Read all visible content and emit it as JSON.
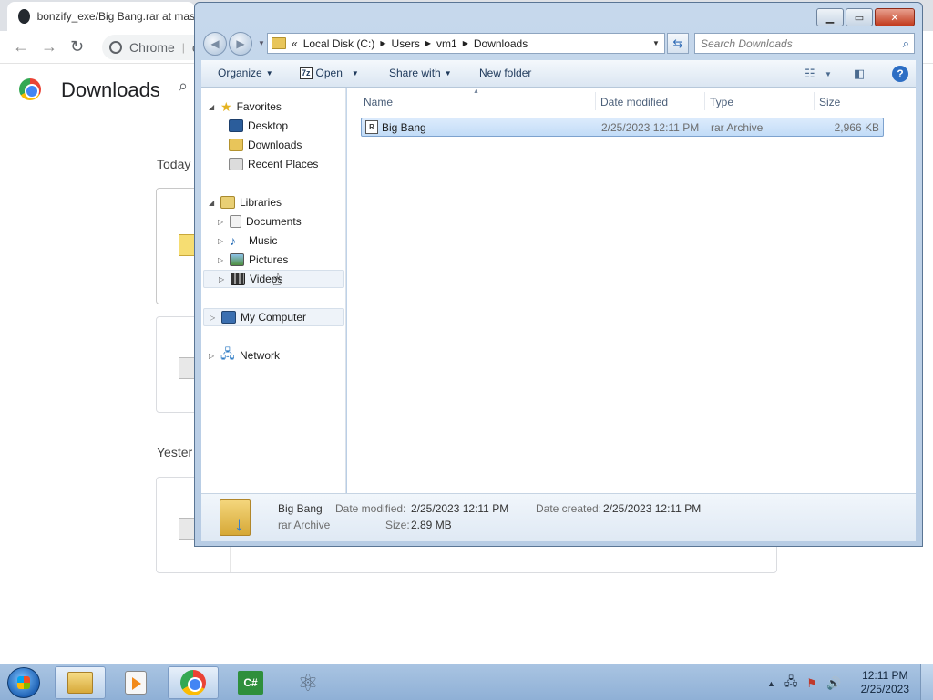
{
  "chrome": {
    "tab_title": "bonzify_exe/Big Bang.rar at mas",
    "omnibox_label": "Chrome",
    "omnibox_sep": "|",
    "omnibox_cut": "c",
    "page_title": "Downloads",
    "section_today": "Today",
    "section_yesterday": "Yester"
  },
  "explorer": {
    "address": [
      "Local Disk (C:)",
      "Users",
      "vm1",
      "Downloads"
    ],
    "address_prefix": "«",
    "search_placeholder": "Search Downloads",
    "commands": {
      "organize": "Organize",
      "open": "Open",
      "share_with": "Share with",
      "new_folder": "New folder"
    },
    "nav": {
      "favorites": "Favorites",
      "desktop": "Desktop",
      "downloads": "Downloads",
      "recent_places": "Recent Places",
      "libraries": "Libraries",
      "documents": "Documents",
      "music": "Music",
      "pictures": "Pictures",
      "videos": "Videos",
      "my_computer": "My Computer",
      "network": "Network"
    },
    "columns": {
      "name": "Name",
      "date_modified": "Date modified",
      "type": "Type",
      "size": "Size"
    },
    "files": [
      {
        "name": "Big Bang",
        "date_modified": "2/25/2023 12:11 PM",
        "type": "rar Archive",
        "size": "2,966 KB"
      }
    ],
    "details": {
      "name": "Big Bang",
      "type": "rar Archive",
      "date_modified_label": "Date modified:",
      "date_modified": "2/25/2023 12:11 PM",
      "date_created_label": "Date created:",
      "date_created": "2/25/2023 12:11 PM",
      "size_label": "Size:",
      "size": "2.89 MB"
    }
  },
  "taskbar": {
    "time": "12:11 PM",
    "date": "2/25/2023",
    "cs_label": "C#"
  },
  "icons": {
    "seven_zip": "7z",
    "rar": "R"
  },
  "colors": {
    "selection": "#cde3f8",
    "window_frame": "#b7cce4",
    "taskbar": "#9fbbdc"
  }
}
